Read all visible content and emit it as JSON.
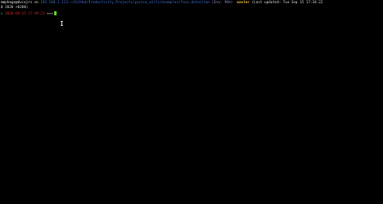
{
  "prompt": {
    "user_host": "mmphego@dvcxjrs",
    "on_word": " on ",
    "ip_path": "192.168.1.113:~/GitHub/Productivity_Projects/pyvino_utils/examples/face_detection",
    "env_info": " (Env: 90%) ",
    "branch": " master ",
    "last_updated": "(Last updated: Tue Sep 15 17:34:22",
    "last_updated_cont": "0 2020 +0200)",
    "arrow": "↳",
    "timestamp": " 2020-09-15 17:49:23 ",
    "symbol": "≈≈≈"
  },
  "colors": {
    "background": "#000000",
    "path": "#3b6fcf",
    "branch": "#e5b63c",
    "timestamp": "#c62828",
    "cursor": "#5fd21f"
  }
}
